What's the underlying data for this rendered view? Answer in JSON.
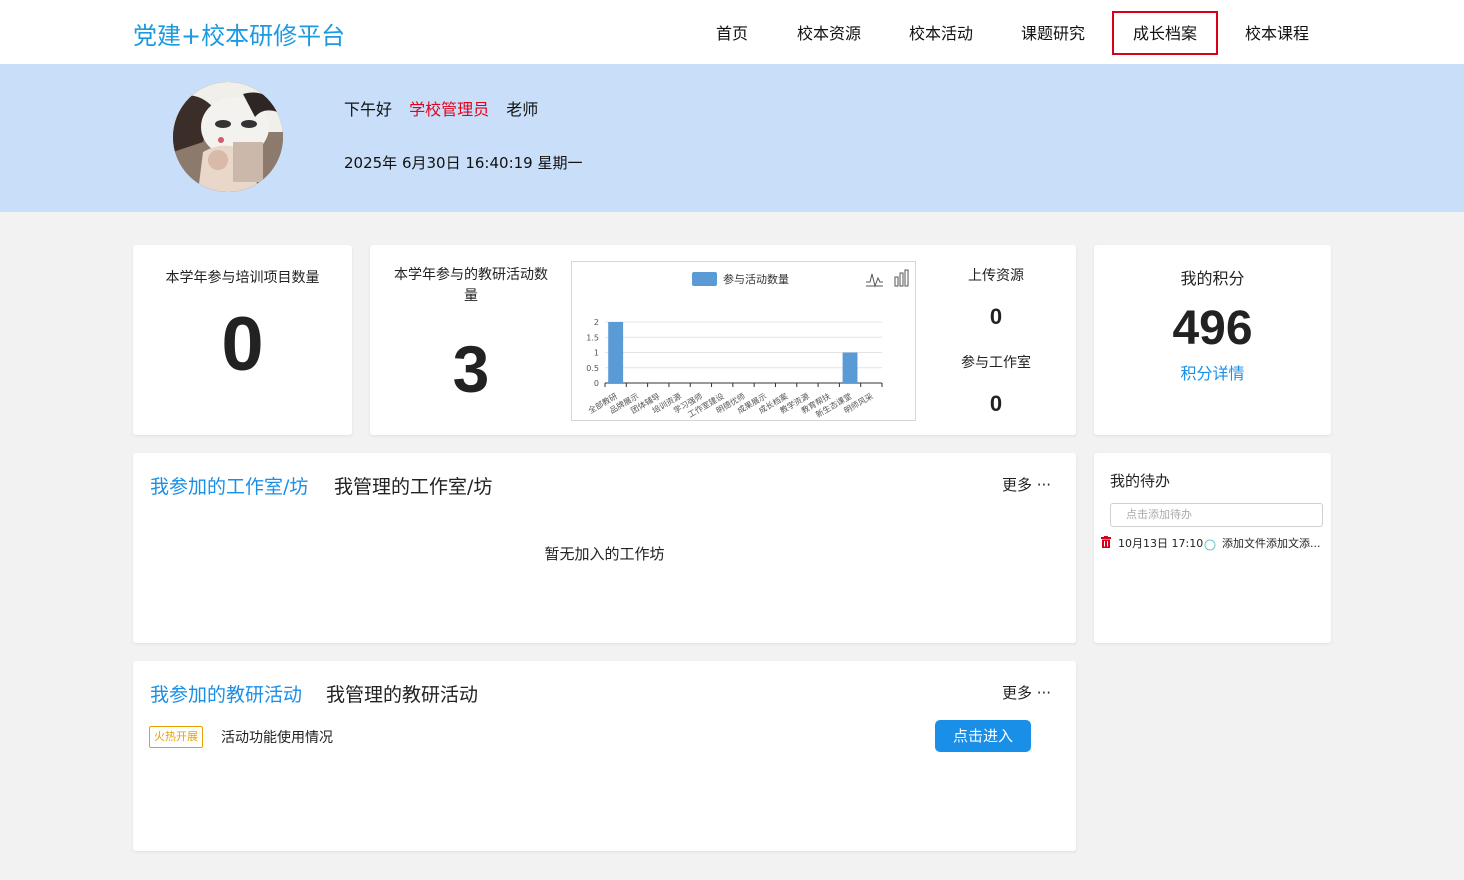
{
  "header": {
    "logo": "党建+校本研修平台",
    "nav": [
      {
        "label": "首页",
        "active": false
      },
      {
        "label": "校本资源",
        "active": false
      },
      {
        "label": "校本活动",
        "active": false
      },
      {
        "label": "课题研究",
        "active": false
      },
      {
        "label": "成长档案",
        "active": true
      },
      {
        "label": "校本课程",
        "active": false
      }
    ]
  },
  "banner": {
    "greeting": "下午好",
    "role": "学校管理员",
    "title_suffix": "老师",
    "datetime": "2025年 6月30日 16:40:19 星期一"
  },
  "stats": {
    "training": {
      "label": "本学年参与培训项目数量",
      "value": "0"
    },
    "activities": {
      "label": "本学年参与的教研活动数量",
      "value": "3"
    },
    "upload": {
      "label": "上传资源",
      "value": "0"
    },
    "studio": {
      "label": "参与工作室",
      "value": "0"
    },
    "points": {
      "label": "我的积分",
      "value": "496",
      "link": "积分详情"
    }
  },
  "chart_data": {
    "type": "bar",
    "legend": "参与活动数量",
    "categories": [
      "全部教研",
      "品牌展示",
      "团体辅导",
      "培训资源",
      "学习强师",
      "工作室建设",
      "明德优师",
      "成果展示",
      "成长档案",
      "教学资源",
      "教育帮扶",
      "新生态课堂",
      "明师风采"
    ],
    "values": [
      2,
      0,
      0,
      0,
      0,
      0,
      0,
      0,
      0,
      0,
      0,
      1,
      0
    ],
    "yticks": [
      "0",
      "0.5",
      "1",
      "1.5",
      "2"
    ],
    "ylim": [
      0,
      2
    ],
    "color": "#5b9bd5"
  },
  "studio_section": {
    "tab_joined": "我参加的工作室/坊",
    "tab_managed": "我管理的工作室/坊",
    "more": "更多 ···",
    "empty": "暂无加入的工作坊"
  },
  "todo": {
    "title": "我的待办",
    "placeholder": "点击添加待办",
    "items": [
      {
        "time": "10月13日 17:10",
        "text": "添加文件添加文添..."
      }
    ]
  },
  "activity_section": {
    "tab_joined": "我参加的教研活动",
    "tab_managed": "我管理的教研活动",
    "more": "更多 ···",
    "items": [
      {
        "badge": "火热开展",
        "title": "活动功能使用情况",
        "button": "点击进入"
      }
    ]
  }
}
